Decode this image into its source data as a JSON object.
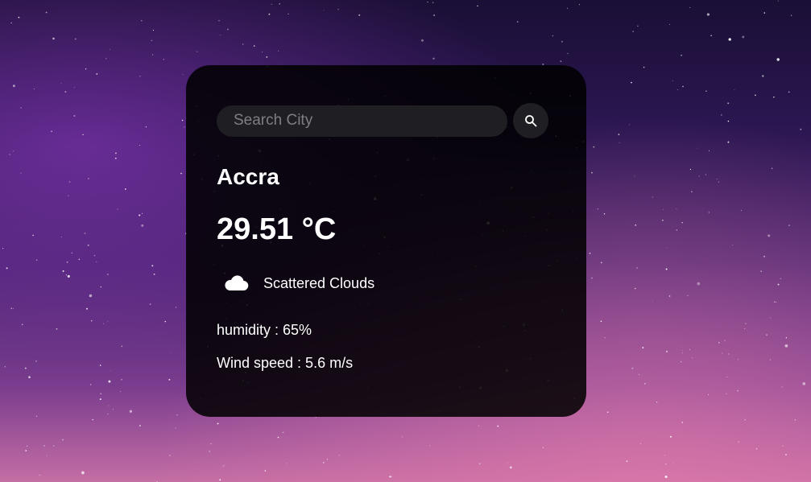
{
  "search": {
    "placeholder": "Search City",
    "button_icon": "search-icon"
  },
  "weather": {
    "city": "Accra",
    "temperature": "29.51 °C",
    "icon": "cloud-icon",
    "description": "Scattered Clouds",
    "humidity": "humidity : 65%",
    "wind": "Wind speed : 5.6 m/s"
  },
  "colors": {
    "card_background": "#000000",
    "input_background": "#1f1e22",
    "text": "#ffffff",
    "placeholder": "#7f7e83"
  }
}
